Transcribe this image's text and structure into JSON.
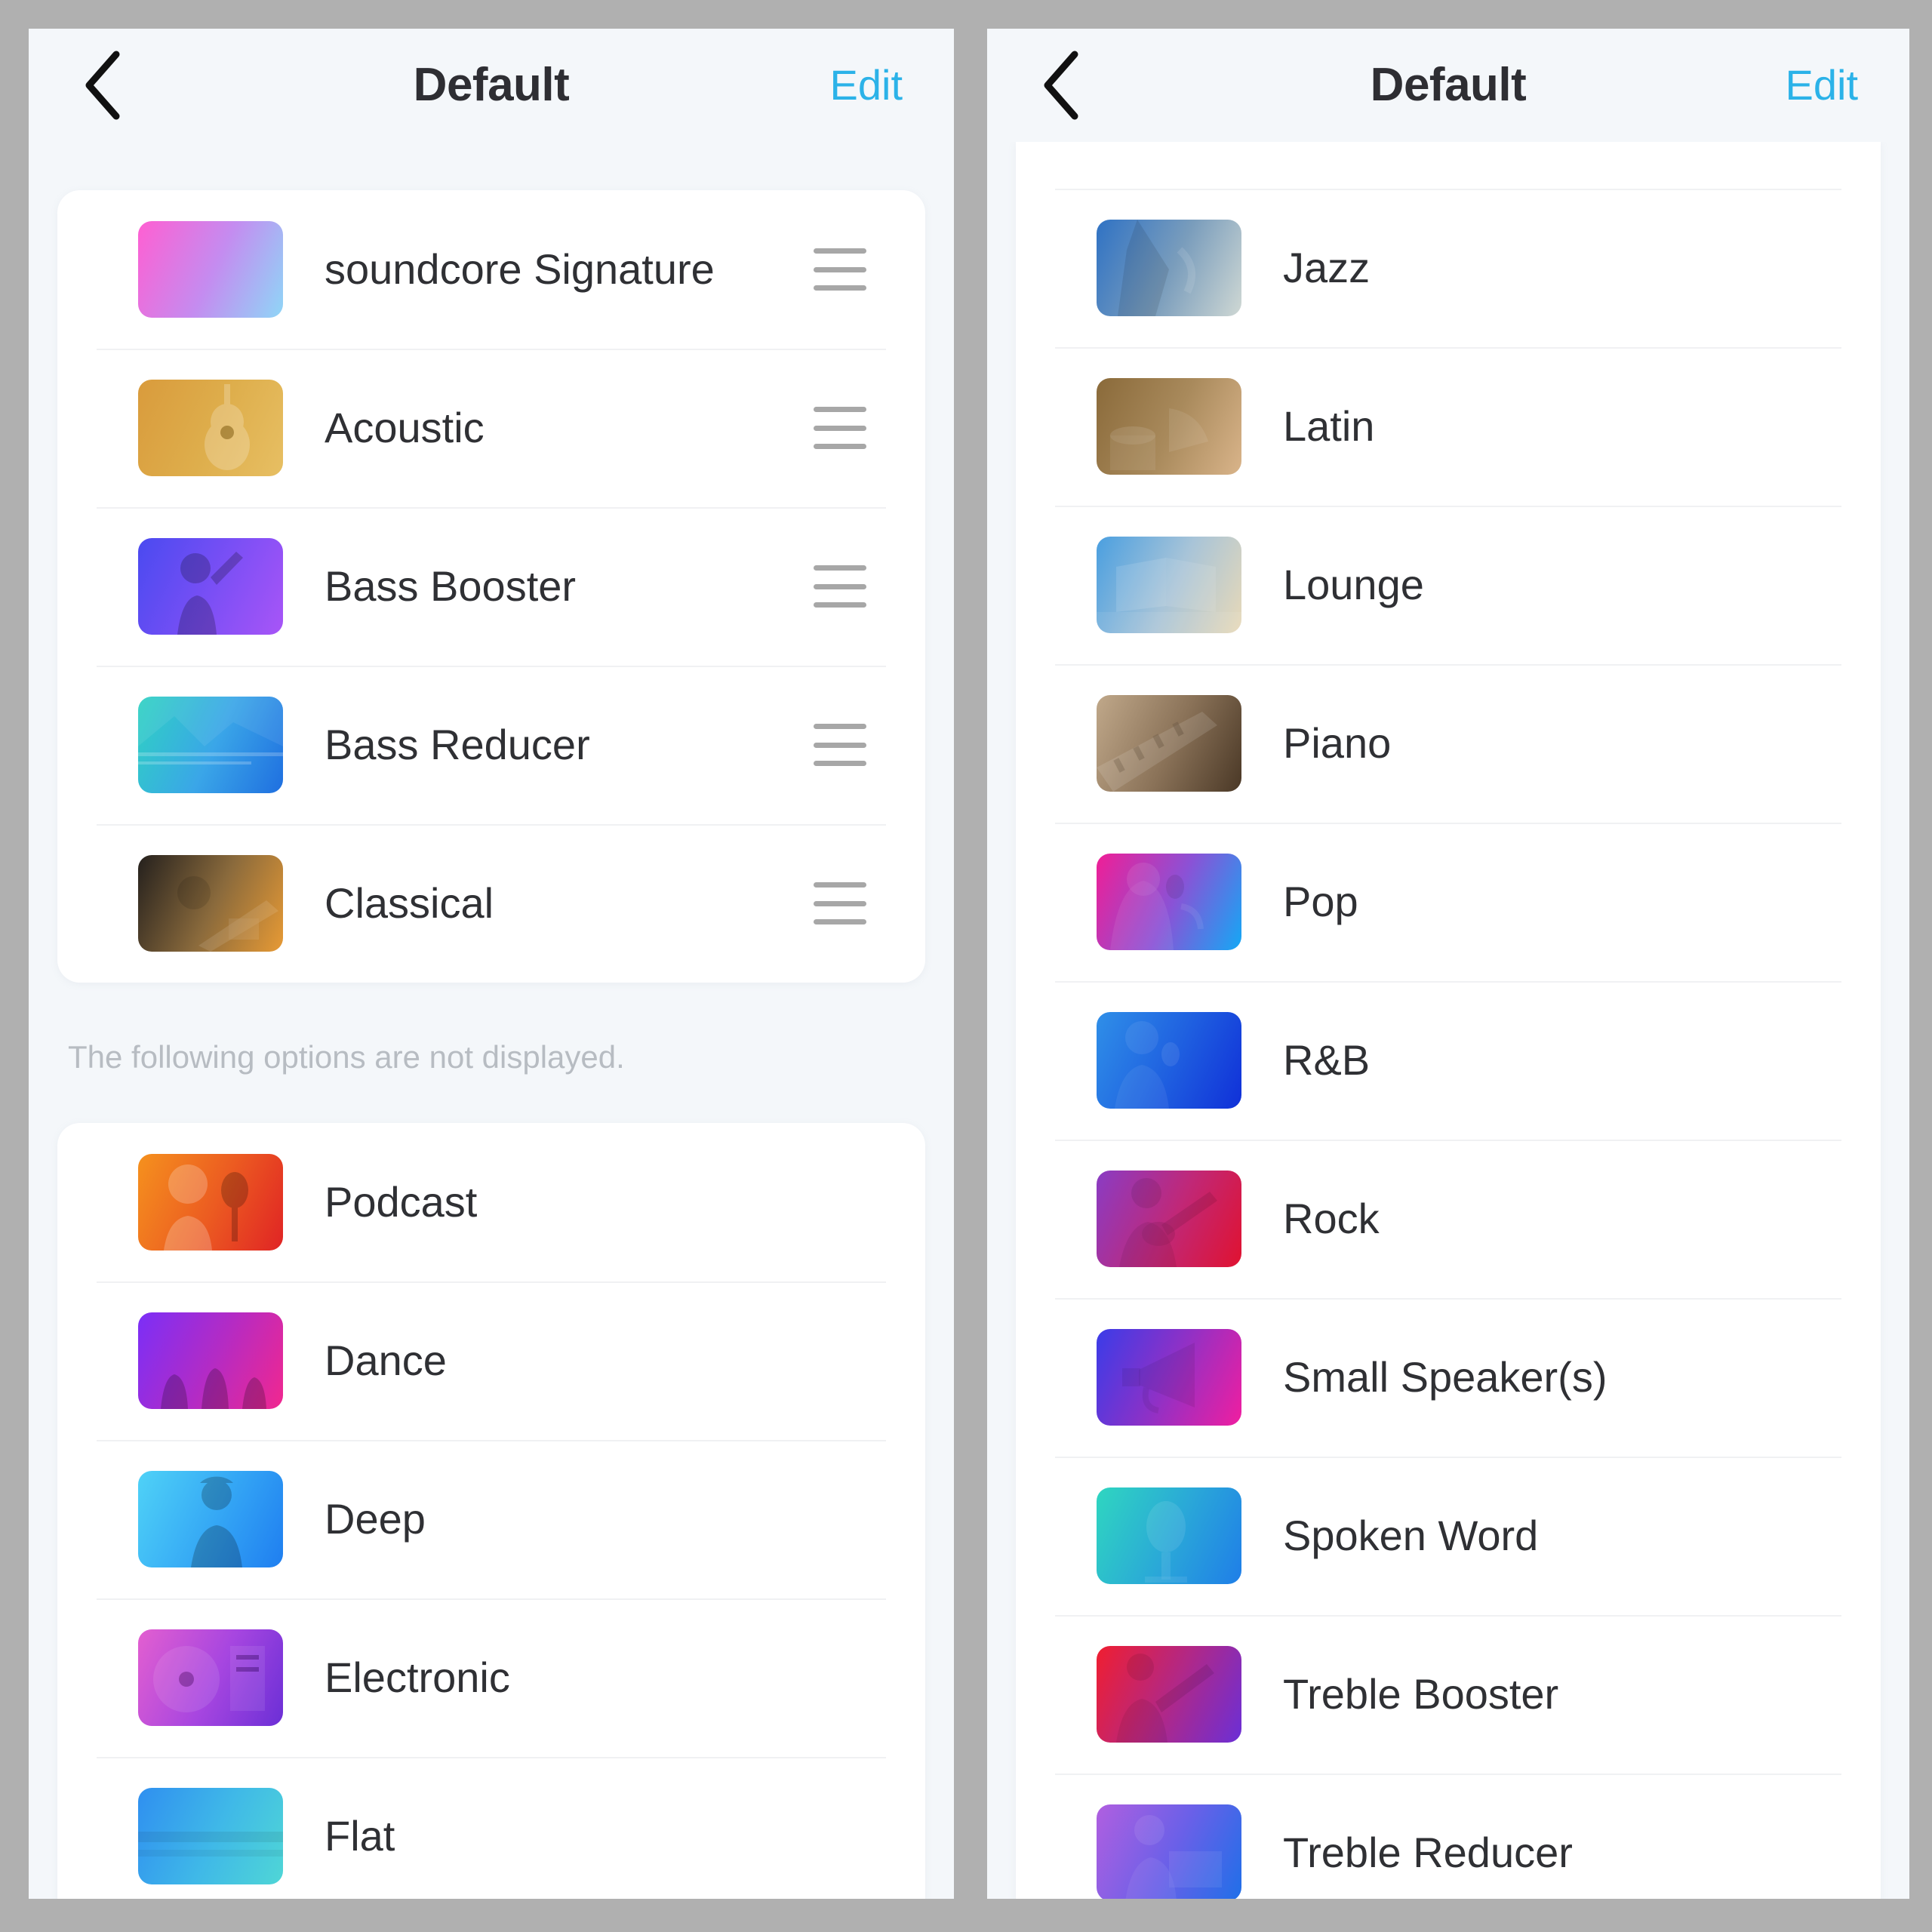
{
  "theme": {
    "page_bg": "#b0b0b0",
    "screen_bg": "#f4f7fa",
    "card_bg": "#ffffff",
    "accent": "#2bb2e8",
    "title_color": "#2e2e33",
    "label_color": "#2f3034",
    "note_color": "#b7bcc2",
    "divider": "#f0f1f3",
    "handle_color": "#a7a7a7"
  },
  "left_panel": {
    "navbar": {
      "back_icon": "chevron-left-icon",
      "title": "Default",
      "edit_label": "Edit"
    },
    "displayed_section": {
      "items": [
        {
          "label": "soundcore Signature",
          "thumb_from": "#ff5fd2",
          "thumb_to": "#8fd6f7",
          "thumb_mid": "#c48cf0",
          "art": "abstract-gradient",
          "has_drag_handle": true
        },
        {
          "label": "Acoustic",
          "thumb_from": "#d99b3c",
          "thumb_to": "#e7bf63",
          "thumb_mid": "#deae4c",
          "art": "acoustic-guitar",
          "has_drag_handle": true
        },
        {
          "label": "Bass Booster",
          "thumb_from": "#4a4af0",
          "thumb_to": "#a855f7",
          "thumb_mid": "#7a4ff5",
          "art": "person-raising-hand",
          "has_drag_handle": true
        },
        {
          "label": "Bass Reducer",
          "thumb_from": "#2fd2c2",
          "thumb_to": "#1f6fe0",
          "thumb_mid": "#3aa6e8",
          "art": "lake-mountains",
          "has_drag_handle": true
        },
        {
          "label": "Classical",
          "thumb_from": "#24201d",
          "thumb_to": "#e79a35",
          "thumb_mid": "#8a6a3c",
          "art": "orchestra-hall",
          "has_drag_handle": true
        }
      ]
    },
    "note": "The following options are not displayed.",
    "hidden_section": {
      "items": [
        {
          "label": "Podcast",
          "thumb_from": "#f5911e",
          "thumb_to": "#e02424",
          "thumb_mid": "#ec5c21",
          "art": "singer-with-microphone",
          "has_drag_handle": false
        },
        {
          "label": "Dance",
          "thumb_from": "#7b2ff7",
          "thumb_to": "#f1278f",
          "thumb_mid": "#b42bc4",
          "art": "dancing-crowd",
          "has_drag_handle": false
        },
        {
          "label": "Deep",
          "thumb_from": "#4fd2f7",
          "thumb_to": "#1f7ef0",
          "thumb_mid": "#35a8f5",
          "art": "seated-person",
          "has_drag_handle": false
        },
        {
          "label": "Electronic",
          "thumb_from": "#e35fd0",
          "thumb_to": "#6b2fd6",
          "thumb_mid": "#a746e0",
          "art": "dj-turntable",
          "has_drag_handle": false
        },
        {
          "label": "Flat",
          "thumb_from": "#2f8ff0",
          "thumb_to": "#4fd6d6",
          "thumb_mid": "#3fb8e8",
          "art": "calm-sea",
          "has_drag_handle": false
        }
      ]
    }
  },
  "right_panel": {
    "navbar": {
      "back_icon": "chevron-left-icon",
      "title": "Default",
      "edit_label": "Edit"
    },
    "scrolled_section": {
      "clipped_top_item": {
        "label": "",
        "thumb_from": "#f5911e",
        "thumb_to": "#e8861c",
        "thumb_mid": "#ef8c1d",
        "art": "partially-scrolled-thumbnail",
        "has_drag_handle": false
      },
      "items": [
        {
          "label": "Jazz",
          "thumb_from": "#2f72c4",
          "thumb_to": "#cfd8d4",
          "thumb_mid": "#7a9dbc",
          "art": "saxophone-player",
          "has_drag_handle": false
        },
        {
          "label": "Latin",
          "thumb_from": "#8a6a3a",
          "thumb_to": "#d9b48a",
          "thumb_mid": "#a98a5c",
          "art": "conga-drums",
          "has_drag_handle": false
        },
        {
          "label": "Lounge",
          "thumb_from": "#4a9fe0",
          "thumb_to": "#e8d9b8",
          "thumb_mid": "#a8c4d8",
          "art": "open-book-bed",
          "has_drag_handle": false
        },
        {
          "label": "Piano",
          "thumb_from": "#c0a88a",
          "thumb_to": "#4a3826",
          "thumb_mid": "#8a7258",
          "art": "piano-keys",
          "has_drag_handle": false
        },
        {
          "label": "Pop",
          "thumb_from": "#f01e96",
          "thumb_to": "#14a8f5",
          "thumb_mid": "#8a52d6",
          "art": "pop-singer",
          "has_drag_handle": false
        },
        {
          "label": "R&B",
          "thumb_from": "#2f8fe8",
          "thumb_to": "#1030d8",
          "thumb_mid": "#1f60e0",
          "art": "vocalist-mic",
          "has_drag_handle": false
        },
        {
          "label": "Rock",
          "thumb_from": "#8a3cc4",
          "thumb_to": "#e01230",
          "thumb_mid": "#c02878",
          "art": "guitarist",
          "has_drag_handle": false
        },
        {
          "label": "Small Speaker(s)",
          "thumb_from": "#3a3ce8",
          "thumb_to": "#f01ea0",
          "thumb_mid": "#9430c4",
          "art": "megaphone",
          "has_drag_handle": false
        },
        {
          "label": "Spoken Word",
          "thumb_from": "#2fd6c0",
          "thumb_to": "#1f7ee8",
          "thumb_mid": "#2aa8d8",
          "art": "studio-microphone",
          "has_drag_handle": false
        },
        {
          "label": "Treble Booster",
          "thumb_from": "#f01e30",
          "thumb_to": "#6b2fd6",
          "thumb_mid": "#b02888",
          "art": "electric-guitarist",
          "has_drag_handle": false
        },
        {
          "label": "Treble Reducer",
          "thumb_from": "#b05fe0",
          "thumb_to": "#1f6fe8",
          "thumb_mid": "#6a60e8",
          "art": "reading-person",
          "has_drag_handle": false
        }
      ]
    }
  }
}
